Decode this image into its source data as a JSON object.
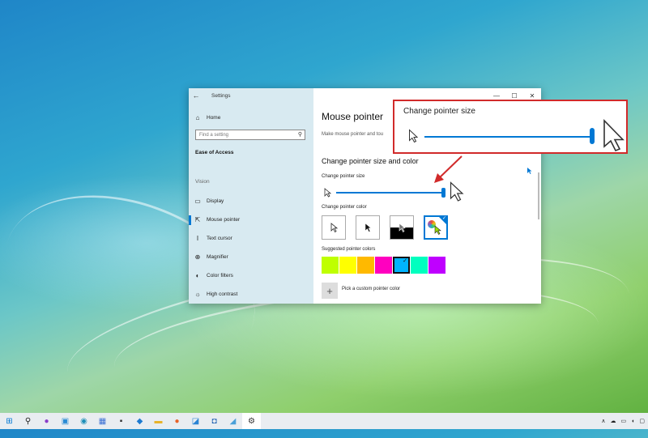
{
  "window": {
    "title": "Settings",
    "controls": {
      "minimize": "—",
      "maximize": "☐",
      "close": "✕"
    }
  },
  "sidebar": {
    "home_label": "Home",
    "search_placeholder": "Find a setting",
    "category_title": "Ease of Access",
    "group_label": "Vision",
    "items": [
      {
        "label": "Display",
        "icon": "display-icon"
      },
      {
        "label": "Mouse pointer",
        "icon": "mouse-pointer-icon",
        "active": true
      },
      {
        "label": "Text cursor",
        "icon": "text-cursor-icon"
      },
      {
        "label": "Magnifier",
        "icon": "magnifier-icon"
      },
      {
        "label": "Color filters",
        "icon": "color-filters-icon"
      },
      {
        "label": "High contrast",
        "icon": "high-contrast-icon"
      }
    ]
  },
  "main": {
    "title": "Mouse pointer",
    "description": "Make mouse pointer and tou",
    "section_title": "Change pointer size and color",
    "size_label": "Change pointer size",
    "size_level": 1.0,
    "color_label": "Change pointer color",
    "color_options": [
      "white",
      "black",
      "inverted",
      "custom"
    ],
    "selected_color_option": "custom",
    "suggested_label": "Suggested pointer colors",
    "suggested_colors": [
      "#bfff00",
      "#ffff00",
      "#ffb900",
      "#ff00bf",
      "#00b4ff",
      "#00ffbf",
      "#bf00ff"
    ],
    "selected_suggested_index": 4,
    "custom_label": "Pick a custom pointer color"
  },
  "callout": {
    "title": "Change pointer size",
    "level": 1.0,
    "border_color": "#d12a2a"
  },
  "taskbar": {
    "icons": [
      "start-icon",
      "search-icon",
      "chat-icon",
      "widgets-icon",
      "edge-icon",
      "store-icon",
      "terminal-icon",
      "vscode-icon",
      "file-explorer-icon",
      "firefox-icon",
      "photos-icon",
      "store-bag-icon",
      "app-icon",
      "settings-icon"
    ]
  },
  "colors": {
    "accent": "#0078d4"
  }
}
